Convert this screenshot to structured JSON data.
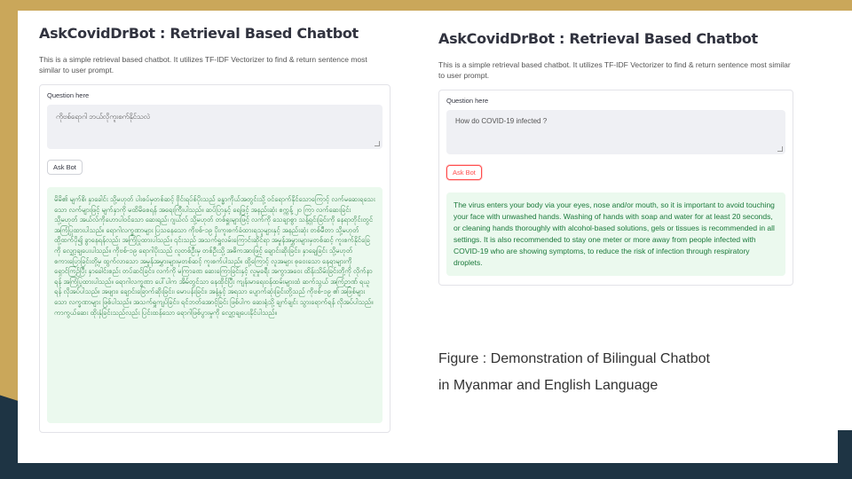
{
  "colors": {
    "gold": "#caa75a",
    "navy": "#1e3444",
    "accent_red": "#ff4b4b",
    "success_bg": "#ebf9ee"
  },
  "left_app": {
    "title": "AskCovidDrBot : Retrieval Based Chatbot",
    "description": "This is a simple retrieval based chatbot. It utilizes TF-IDF Vectorizer to find & return sentence most similar to user prompt.",
    "question_label": "Question here",
    "question_value": "ကိုဗစ်ရောဂါ ဘယ်လိုကူးစက်နိုင်သလဲ",
    "button_label": "Ask Bot",
    "answer": "မိမိ၏ မျက်စိ၊ နှာခေါင်း သို့မဟုတ် ပါးစပ်မှတစ်ဆင့် ဗိုင်းရပ်စ်ပိုးသည် ခန္ဓာကိုယ်အတွင်းသို့ ဝင်ရောက်နိုင်သောကြောင့် လက်မဆေးရသေးသော လက်များဖြင့် မျက်နှာကို မထိမိစေရန် အရေးကြီးပါသည်။ ဆပ်ပြာနှင့် ရေဖြင့် အနည်းဆုံး စက္ကန့် ၂၀ ကြာ လက်ဆေးခြင်း သို့မဟုတ် အယ်လ်ကိုဟောပါဝင်သော ဆေးရည်၊ ဂျယ်လ် သို့မဟုတ် တစ်ရှူးများဖြင့် လက်ကို သေချာစွာ သန့်ရှင်းခြင်းကို နေရာတိုင်းတွင် အကြံပြုထားပါသည်။ ရောဂါလက္ခဏာများ ပြသနေသော ကိုဗစ်-၁၉ ပိုးကူးစက်ခံထားရသူများနှင့် အနည်းဆုံး တစ်မီတာ သို့မဟုတ် ထို့ထက်ပို၍ ခွာနေရန်လည်း အကြံပြုထားပါသည်။ ၎င်းသည် အသက်ရှူလမ်းကြောင်းဆိုင်ရာ အမှုန်အမွှားများမှတစ်ဆင့် ကူးစက်နိုင်ခြေကို လျှော့ချပေးပါသည်။ ကိုဗစ်-၁၉ ရောဂါပိုးသည် လူတစ်ဦးမှ တစ်ဦးသို့ အဓိကအားဖြင့် ချောင်းဆိုးခြင်း၊ နှာချေခြင်း သို့မဟုတ် စကားပြောခြင်းတို့မှ ထွက်လာသော အမှုန်အမွှားများမှတစ်ဆင့် ကူးစက်ပါသည်။ ထို့ကြောင့် လူအများ စုဝေးသော နေရာများကို ရှောင်ကြဉ်ပြီး နှာခေါင်းစည်း တပ်ဆင်ခြင်း၊ လက်ကို မကြာခဏ ဆေးကြောခြင်းနှင့် လူမှုခရီး အကွာအဝေး ထိန်းသိမ်းခြင်းတို့ကို လိုက်နာရန် အကြံပြုထားပါသည်။ ရောဂါလက္ခဏာ ပေါ်ပါက အိမ်တွင်သာ နေထိုင်ပြီး ကျန်းမာရေးဝန်ထမ်းများထံ ဆက်သွယ် အကြံဉာဏ် ရယူရန် လိုအပ်ပါသည်။ အဖျား၊ ချောင်းခြောက်ဆိုးခြင်း၊ မောပန်းခြင်း၊ အနံ့နှင့် အရသာ ပျောက်ဆုံးခြင်းတို့သည် ကိုဗစ်-၁၉ ၏ အဖြစ်များသော လက္ခဏာများ ဖြစ်ပါသည်။ အသက်ရှူကျပ်ခြင်း၊ ရင်ဘတ်အောင့်ခြင်း ဖြစ်ပါက ဆေးရုံသို့ ချက်ချင်း သွားရောက်ရန် လိုအပ်ပါသည်။ ကာကွယ်ဆေး ထိုးနှံခြင်းသည်လည်း ပြင်းထန်သော ရောဂါဖြစ်ပွားမှုကို လျှော့ချပေးနိုင်ပါသည်။"
  },
  "right_app": {
    "title": "AskCovidDrBot : Retrieval Based Chatbot",
    "description": "This is a simple retrieval based chatbot. It utilizes TF-IDF Vectorizer to find & return sentence most similar to user prompt.",
    "question_label": "Question here",
    "question_value": "How do COVID-19 infected ?",
    "button_label": "Ask Bot",
    "answer": "The virus enters your body via your eyes, nose and/or mouth, so it is important to avoid touching your face with unwashed hands. Washing of hands with soap and water for at least 20 seconds, or cleaning hands thoroughly with alcohol-based solutions, gels or tissues is recommended in all settings. It is also recommended to stay one meter or more away from people infected with COVID-19 who are showing symptoms, to reduce the risk of infection through respiratory droplets."
  },
  "caption": {
    "line1": "Figure : Demonstration of Bilingual Chatbot",
    "line2": "in Myanmar and English Language"
  }
}
